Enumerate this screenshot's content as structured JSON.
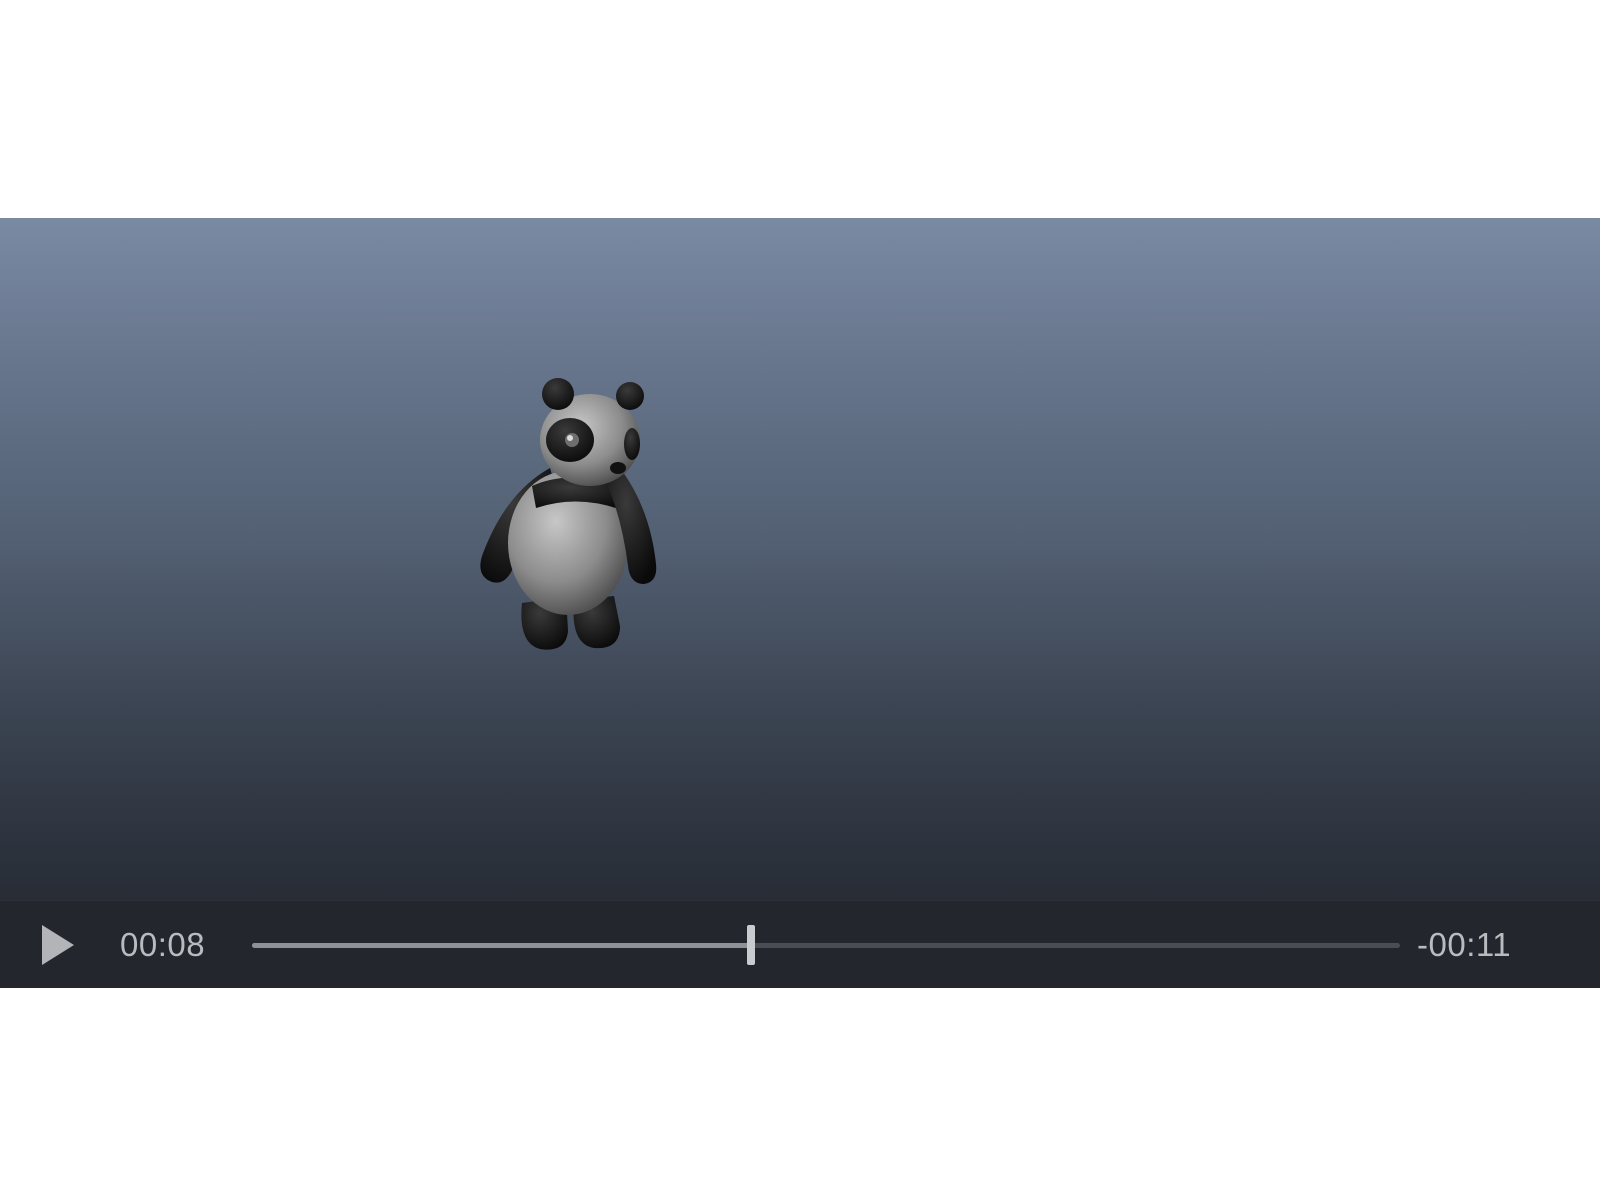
{
  "player": {
    "elapsed_time": "00:08",
    "remaining_time": "-00:11",
    "progress_fraction": 0.435,
    "state": "paused"
  },
  "icons": {
    "play": "play-icon"
  },
  "colors": {
    "viewport_top": "#7a8aa3",
    "viewport_bottom": "#272c35",
    "controls_bg": "#23262c",
    "text": "#b9bbbf"
  }
}
